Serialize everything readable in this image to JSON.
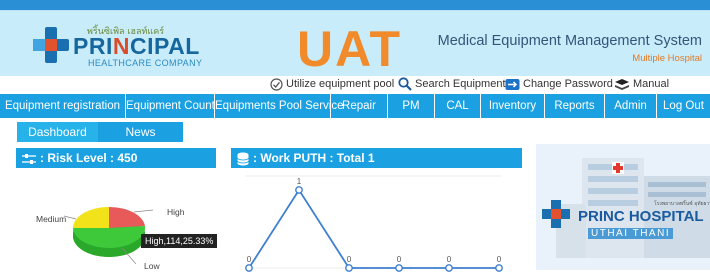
{
  "header": {
    "logo_thai": "พริ้นซิเพิล เฮลท์แคร์",
    "logo_pre": "PRI",
    "logo_n": "N",
    "logo_post": "CIPAL",
    "logo_tagline": "HEALTHCARE COMPANY",
    "env_badge": "UAT",
    "system_title": "Medical Equipment Management System",
    "system_sub": "Multiple Hospital"
  },
  "toolbar": {
    "utilize": "Utilize equipment pool",
    "search": "Search Equipment",
    "change_password": "Change Password",
    "manual": "Manual"
  },
  "nav": [
    "Equipment registration",
    "Equipment Count",
    "Equipments Pool Service",
    "Repair",
    "PM",
    "CAL",
    "Inventory",
    "Reports",
    "Admin",
    "Log Out"
  ],
  "subnav": [
    "Dashboard",
    "News"
  ],
  "risk_panel": {
    "title": ": Risk Level : 450",
    "tooltip": "High,114,25.33%"
  },
  "work_panel": {
    "title": ": Work PUTH : Total 1"
  },
  "hospital": {
    "name": "PRINC HOSPITAL",
    "sub": "UTHAI THANI",
    "thai": "โรงพยาบาลพริ้นซ์ อุทัยธานี"
  },
  "chart_data": [
    {
      "type": "pie",
      "labels": [
        "High",
        "Medium",
        "Low"
      ],
      "values": [
        114,
        null,
        null
      ],
      "percent_high": 25.33,
      "colors": [
        "#e85a5a",
        "#f2e21a",
        "#3ec93a"
      ],
      "total": 450
    },
    {
      "type": "line",
      "x": [
        "",
        "",
        "",
        "",
        "",
        ""
      ],
      "values": [
        0,
        1,
        0,
        0,
        0,
        0
      ],
      "ylim": [
        0,
        1
      ],
      "colors": [
        "#3f7fd0"
      ],
      "data_labels": [
        "0",
        "1",
        "0",
        "0",
        "0",
        "0"
      ]
    }
  ],
  "colors": {
    "accent": "#1ba1e2",
    "header_bg": "#c9ecfb",
    "uat": "#f08a2a"
  }
}
